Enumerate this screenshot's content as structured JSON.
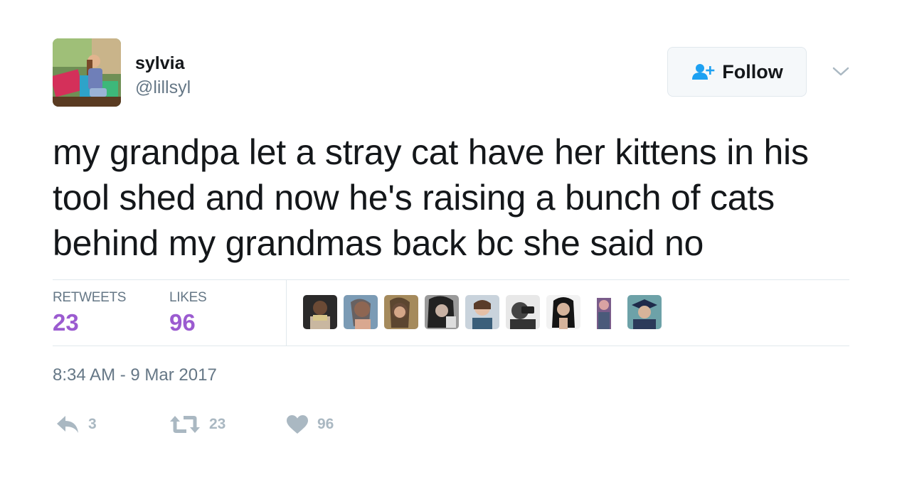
{
  "user": {
    "display_name": "sylvia",
    "handle": "@lillsyl"
  },
  "follow_button": {
    "label": "Follow",
    "icon": "add-user-icon"
  },
  "menu": {
    "icon": "chevron-down-icon"
  },
  "tweet": {
    "text": "my grandpa let a stray cat have her kittens in his tool shed and now he's raising a bunch of cats behind my grandmas back bc she said no",
    "timestamp": "8:34 AM - 9 Mar 2017"
  },
  "stats": {
    "retweets_label": "RETWEETS",
    "retweets_count": "23",
    "likes_label": "LIKES",
    "likes_count": "96"
  },
  "likers": [
    {
      "name": "liker-avatar"
    },
    {
      "name": "liker-avatar"
    },
    {
      "name": "liker-avatar"
    },
    {
      "name": "liker-avatar"
    },
    {
      "name": "liker-avatar"
    },
    {
      "name": "liker-avatar"
    },
    {
      "name": "liker-avatar"
    },
    {
      "name": "liker-avatar"
    },
    {
      "name": "liker-avatar"
    }
  ],
  "actions": {
    "reply_count": "3",
    "retweet_count": "23",
    "like_count": "96"
  },
  "colors": {
    "stat_value": "#9b5bd0",
    "follow_icon": "#1da1f2",
    "muted": "#657786",
    "action_gray": "#aab8c2",
    "border": "#e1e8ed"
  }
}
